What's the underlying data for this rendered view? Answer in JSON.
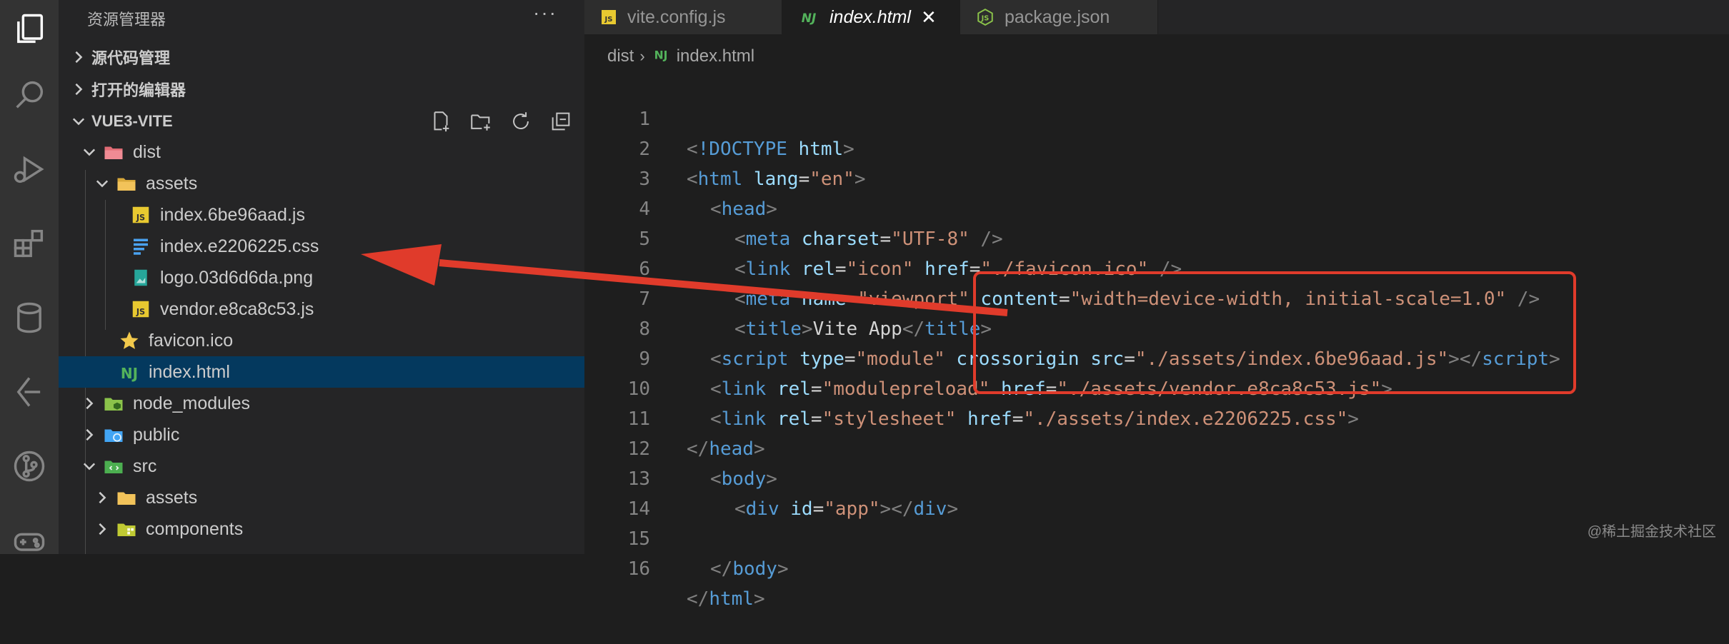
{
  "sidebar": {
    "title": "资源管理器",
    "more": "···",
    "sections": {
      "source_control": "源代码管理",
      "open_editors": "打开的编辑器",
      "project": "VUE3-VITE"
    },
    "tree": [
      {
        "label": "dist"
      },
      {
        "label": "assets"
      },
      {
        "label": "index.6be96aad.js"
      },
      {
        "label": "index.e2206225.css"
      },
      {
        "label": "logo.03d6d6da.png"
      },
      {
        "label": "vendor.e8ca8c53.js"
      },
      {
        "label": "favicon.ico"
      },
      {
        "label": "index.html"
      },
      {
        "label": "node_modules"
      },
      {
        "label": "public"
      },
      {
        "label": "src"
      },
      {
        "label": "assets"
      },
      {
        "label": "components"
      }
    ]
  },
  "tabs": [
    {
      "label": "vite.config.js",
      "icon": "js-icon"
    },
    {
      "label": "index.html",
      "icon": "nj-icon",
      "close": "✕"
    },
    {
      "label": "package.json",
      "icon": "node-icon"
    }
  ],
  "breadcrumb": {
    "folder": "dist",
    "sep": "›",
    "file": "index.html"
  },
  "code": {
    "line_numbers": [
      "1",
      "2",
      "3",
      "4",
      "5",
      "6",
      "7",
      "8",
      "9",
      "10",
      "11",
      "12",
      "13",
      "14",
      "15",
      "16"
    ],
    "l1": {
      "open": "<",
      "doctype": "!DOCTYPE",
      "html": " html",
      "close": ">"
    },
    "l2": {
      "open": "<",
      "tag": "html",
      "attr": " lang",
      "eq": "=",
      "val": "\"en\"",
      "close": ">"
    },
    "l3": {
      "open": "<",
      "tag": "head",
      "close": ">"
    },
    "l4": {
      "open": "<",
      "tag": "meta",
      "attr": " charset",
      "eq": "=",
      "val": "\"UTF-8\"",
      "close": " />"
    },
    "l5": {
      "open": "<",
      "tag": "link",
      "a1": " rel",
      "eq1": "=",
      "v1": "\"icon\"",
      "a2": " href",
      "eq2": "=",
      "v2": "\"./favicon.ico\"",
      "close": " />"
    },
    "l6": {
      "open": "<",
      "tag": "meta",
      "a1": " name",
      "eq1": "=",
      "v1": "\"viewport\"",
      "a2": " content",
      "eq2": "=",
      "v2": "\"width=device-width, initial-scale=1.0\"",
      "close": " />"
    },
    "l7": {
      "open": "<",
      "tag": "title",
      "close": ">",
      "text": "Vite App",
      "open2": "</",
      "tag2": "title",
      "close2": ">"
    },
    "l8": {
      "open": "<",
      "tag": "script",
      "a1": " type",
      "eq1": "=",
      "v1": "\"module\"",
      "a2": " crossorigin",
      "a3": " src",
      "eq3": "=",
      "v3": "\"./assets/index.6be96aad.js\"",
      "close": ">",
      "open2": "</",
      "tag2": "script",
      "close2": ">"
    },
    "l9": {
      "open": "<",
      "tag": "link",
      "a1": " rel",
      "eq1": "=",
      "v1": "\"modulepreload\"",
      "a2": " href",
      "eq2": "=",
      "v2": "\"./assets/vendor.e8ca8c53.js\"",
      "close": ">"
    },
    "l10": {
      "open": "<",
      "tag": "link",
      "a1": " rel",
      "eq1": "=",
      "v1": "\"stylesheet\"",
      "a2": " href",
      "eq2": "=",
      "v2": "\"./assets/index.e2206225.css\"",
      "close": ">"
    },
    "l11": {
      "open": "</",
      "tag": "head",
      "close": ">"
    },
    "l12": {
      "open": "<",
      "tag": "body",
      "close": ">"
    },
    "l13": {
      "open": "<",
      "tag": "div",
      "attr": " id",
      "eq": "=",
      "val": "\"app\"",
      "close": ">",
      "open2": "</",
      "tag2": "div",
      "close2": ">"
    },
    "l15": {
      "open": "</",
      "tag": "body",
      "close": ">"
    },
    "l16": {
      "open": "</",
      "tag": "html",
      "close": ">"
    }
  },
  "watermark": "@稀土掘金技术社区",
  "colors": {
    "accent_selected": "#04395e",
    "annotation_red": "#e03b2b",
    "js_yellow": "#e8c930",
    "css_blue": "#4aa2f0",
    "nj_green": "#53b25b"
  }
}
